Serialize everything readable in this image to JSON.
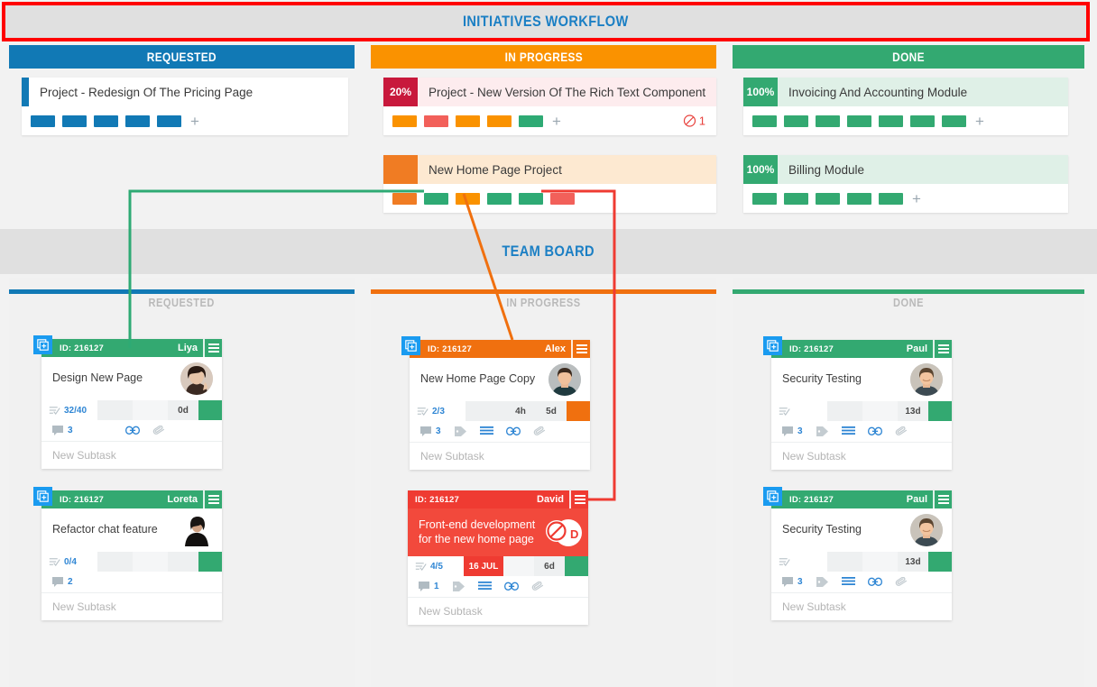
{
  "initiatives_banner": {
    "title": "INITIATIVES WORKFLOW",
    "accent": "#1b7fc4",
    "border": "#ff0000"
  },
  "initiatives_columns": [
    {
      "name": "requested",
      "label": "REQUESTED",
      "color": "#1179b5"
    },
    {
      "name": "in_progress",
      "label": "IN PROGRESS",
      "color": "#fa9200"
    },
    {
      "name": "done",
      "label": "DONE",
      "color": "#33a971"
    }
  ],
  "initiatives": {
    "requested": [
      {
        "badge": "",
        "badge_color": "#1179b5",
        "title": "Project - Redesign Of The Pricing Page",
        "title_bg": "#ffffff",
        "chips": [
          "#1179b5",
          "#1179b5",
          "#1179b5",
          "#1179b5",
          "#1179b5"
        ],
        "add_label": "+",
        "blocked": null
      }
    ],
    "in_progress": [
      {
        "badge": "20%",
        "badge_color": "#c8193c",
        "title": "Project - New Version Of The Rich Text Component",
        "title_bg": "#fdecee",
        "chips": [
          "#fa9200",
          "#f2605a",
          "#fa9200",
          "#fa9200",
          "#2eaa74"
        ],
        "add_label": "+",
        "blocked": "1"
      },
      {
        "badge": "",
        "badge_color": "#f07c23",
        "title": "New Home Page Project",
        "title_bg": "#fde9d1",
        "chips": [
          "#f07c23",
          "#2eaa74",
          "#fa9200",
          "#2eaa74",
          "#2eaa74",
          "#f2605a"
        ],
        "add_label": "",
        "blocked": null
      }
    ],
    "done": [
      {
        "badge": "100%",
        "badge_color": "#33a971",
        "title": "Invoicing And Accounting Module",
        "title_bg": "#dff0e7",
        "chips": [
          "#33a971",
          "#33a971",
          "#33a971",
          "#33a971",
          "#33a971",
          "#33a971",
          "#33a971"
        ],
        "add_label": "+",
        "blocked": null
      },
      {
        "badge": "100%",
        "badge_color": "#33a971",
        "title": "Billing Module",
        "title_bg": "#dff0e7",
        "chips": [
          "#33a971",
          "#33a971",
          "#33a971",
          "#33a971",
          "#33a971"
        ],
        "add_label": "+",
        "blocked": null
      }
    ]
  },
  "team_banner": {
    "title": "TEAM BOARD",
    "accent": "#1b7fc4"
  },
  "team_columns": [
    {
      "name": "requested",
      "label": "REQUESTED",
      "color": "#1179b5"
    },
    {
      "name": "in_progress",
      "label": "IN PROGRESS",
      "color": "#f0700f"
    },
    {
      "name": "done",
      "label": "DONE",
      "color": "#33a971"
    }
  ],
  "tasks": {
    "requested": [
      {
        "id_label": "ID: 216127",
        "owner": "Liya",
        "header_color": "#33a971",
        "title": "Design New Page",
        "title_red": false,
        "has_add_button": true,
        "avatar": "woman-dark-hair",
        "subtasks": "32/40",
        "date_badge": "",
        "days": "0d",
        "end_color": "#33a971",
        "comments": "3",
        "icons": [
          "comment",
          "link",
          "attachment"
        ],
        "new_subtask": "New Subtask",
        "blocked": false
      },
      {
        "id_label": "ID: 216127",
        "owner": "Loreta",
        "header_color": "#33a971",
        "title": "Refactor chat feature",
        "title_red": false,
        "has_add_button": true,
        "avatar": "woman-hood",
        "subtasks": "0/4",
        "date_badge": "",
        "days": "",
        "end_color": "#33a971",
        "comments": "2",
        "icons": [
          "comment"
        ],
        "new_subtask": "New Subtask",
        "blocked": false
      }
    ],
    "in_progress": [
      {
        "id_label": "ID: 216127",
        "owner": "Alex",
        "header_color": "#f0700f",
        "title": "New Home Page Copy",
        "title_red": false,
        "has_add_button": true,
        "avatar": "man-dark-shirt",
        "subtasks": "2/3",
        "date_badge": "",
        "days": "5d",
        "hours": "4h",
        "end_color": "#f0700f",
        "comments": "3",
        "icons": [
          "comment",
          "tag",
          "lines",
          "link",
          "attachment"
        ],
        "new_subtask": "New Subtask",
        "blocked": false
      },
      {
        "id_label": "ID: 216127",
        "owner": "David",
        "header_color": "#ef3b32",
        "title": "Front-end development for the new home page",
        "title_red": true,
        "has_add_button": false,
        "avatar": "blocked-D",
        "subtasks": "4/5",
        "date_badge": "16 JUL",
        "date_color": "#ef3b32",
        "days": "6d",
        "end_color": "#33a971",
        "comments": "1",
        "icons": [
          "comment",
          "tag",
          "lines",
          "link",
          "attachment"
        ],
        "new_subtask": "New Subtask",
        "blocked": true
      }
    ],
    "done": [
      {
        "id_label": "ID: 216127",
        "owner": "Paul",
        "header_color": "#33a971",
        "title": "Security Testing",
        "title_red": false,
        "has_add_button": true,
        "avatar": "man-smiling",
        "subtasks": "",
        "date_badge": "",
        "days": "13d",
        "end_color": "#33a971",
        "comments": "3",
        "icons": [
          "comment",
          "tag",
          "lines",
          "link",
          "attachment"
        ],
        "new_subtask": "New Subtask",
        "blocked": false
      },
      {
        "id_label": "ID: 216127",
        "owner": "Paul",
        "header_color": "#33a971",
        "title": "Security Testing",
        "title_red": false,
        "has_add_button": true,
        "avatar": "man-smiling",
        "subtasks": "",
        "date_badge": "",
        "days": "13d",
        "end_color": "#33a971",
        "comments": "3",
        "icons": [
          "comment",
          "tag",
          "lines",
          "link",
          "attachment"
        ],
        "new_subtask": "New Subtask",
        "blocked": false
      }
    ]
  },
  "connectors": [
    {
      "name": "green-connector",
      "color": "#2eaa74"
    },
    {
      "name": "orange-connector",
      "color": "#f0700f"
    },
    {
      "name": "red-connector",
      "color": "#ef3b32"
    }
  ]
}
